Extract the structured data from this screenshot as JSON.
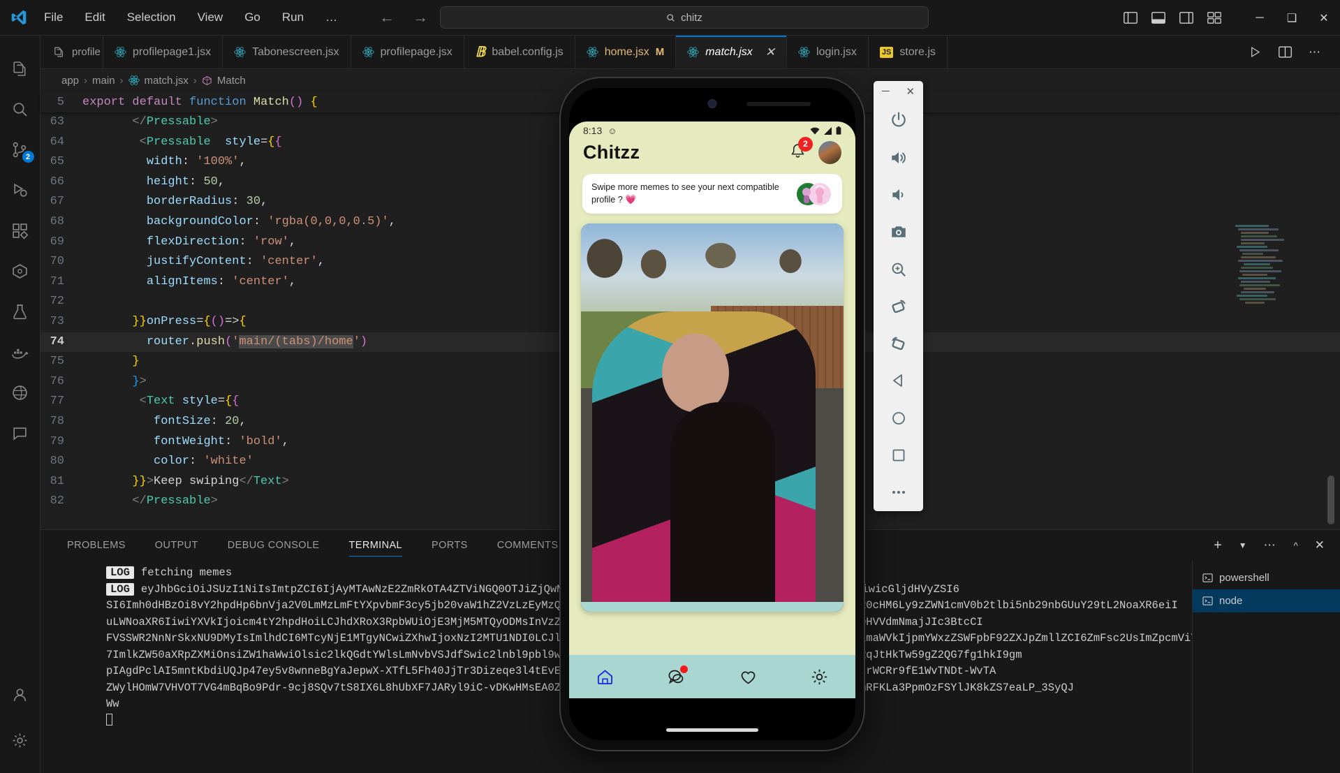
{
  "titlebar": {
    "menu": [
      "File",
      "Edit",
      "Selection",
      "View",
      "Go",
      "Run",
      "…"
    ],
    "search_value": "chitz",
    "search_icon": "search-icon",
    "back_icon": "arrow-left-icon",
    "forward_icon": "arrow-right-icon",
    "minimize": "─",
    "maximize": "❑",
    "close": "✕"
  },
  "activitybar": {
    "items": [
      {
        "name": "explorer",
        "icon": "files-icon",
        "badge": ""
      },
      {
        "name": "search",
        "icon": "search-icon",
        "badge": ""
      },
      {
        "name": "source-control",
        "icon": "source-control-icon",
        "badge": "2"
      },
      {
        "name": "run-and-debug",
        "icon": "run-debug-icon",
        "badge": ""
      },
      {
        "name": "extensions",
        "icon": "extensions-icon",
        "badge": ""
      },
      {
        "name": "remote-explorer",
        "icon": "remote-explorer-icon",
        "badge": ""
      },
      {
        "name": "testing",
        "icon": "beaker-icon",
        "badge": ""
      },
      {
        "name": "docker",
        "icon": "docker-icon",
        "badge": ""
      },
      {
        "name": "database",
        "icon": "database-icon",
        "badge": ""
      },
      {
        "name": "chat",
        "icon": "comment-icon",
        "badge": ""
      }
    ],
    "bottom": [
      {
        "name": "accounts",
        "icon": "account-icon"
      },
      {
        "name": "settings",
        "icon": "gear-icon"
      }
    ]
  },
  "tabbar": {
    "sidebar_label": "profile",
    "tabs": [
      {
        "label": "profilepage1.jsx",
        "icon": "react-icon",
        "active": false,
        "modified": "",
        "closeable": false
      },
      {
        "label": "Tabonescreen.jsx",
        "icon": "react-icon",
        "active": false,
        "modified": "",
        "closeable": false
      },
      {
        "label": "profilepage.jsx",
        "icon": "react-icon",
        "active": false,
        "modified": "",
        "closeable": false
      },
      {
        "label": "babel.config.js",
        "icon": "babel-icon",
        "active": false,
        "modified": "",
        "closeable": false
      },
      {
        "label": "home.jsx",
        "icon": "react-icon",
        "active": false,
        "modified": "M",
        "closeable": false
      },
      {
        "label": "match.jsx",
        "icon": "react-icon",
        "active": true,
        "modified": "",
        "closeable": true
      },
      {
        "label": "login.jsx",
        "icon": "react-icon",
        "active": false,
        "modified": "",
        "closeable": false
      },
      {
        "label": "store.js",
        "icon": "js-icon",
        "active": false,
        "modified": "",
        "closeable": false
      }
    ],
    "actions": [
      {
        "name": "run-file-button",
        "icon": "play-icon"
      },
      {
        "name": "split-editor-button",
        "icon": "split-icon"
      },
      {
        "name": "more-actions-button",
        "icon": "ellipsis-icon"
      }
    ]
  },
  "breadcrumb": {
    "parts": [
      "app",
      "main",
      "match.jsx",
      "Match"
    ]
  },
  "editor": {
    "sticky_line_number": "5",
    "sticky_code": "export default function Match() {",
    "current_line": "74",
    "lines": [
      {
        "n": "63",
        "indent": 7,
        "text": "</Pressable>"
      },
      {
        "n": "64",
        "indent": 8,
        "text": "<Pressable  style={{"
      },
      {
        "n": "65",
        "indent": 9,
        "text": "width: '100%',"
      },
      {
        "n": "66",
        "indent": 9,
        "text": "height: 50,"
      },
      {
        "n": "67",
        "indent": 9,
        "text": "borderRadius: 30,"
      },
      {
        "n": "68",
        "indent": 9,
        "text": "backgroundColor: 'rgba(0,0,0,0.5)',"
      },
      {
        "n": "69",
        "indent": 9,
        "text": "flexDirection: 'row',"
      },
      {
        "n": "70",
        "indent": 9,
        "text": "justifyContent: 'center',"
      },
      {
        "n": "71",
        "indent": 9,
        "text": "alignItems: 'center',"
      },
      {
        "n": "72",
        "indent": 0,
        "text": ""
      },
      {
        "n": "73",
        "indent": 7,
        "text": "}}onPress={()=>{"
      },
      {
        "n": "74",
        "indent": 9,
        "text": "router.push('main/(tabs)/home')"
      },
      {
        "n": "75",
        "indent": 7,
        "text": "}"
      },
      {
        "n": "76",
        "indent": 7,
        "text": "}>"
      },
      {
        "n": "77",
        "indent": 8,
        "text": "<Text style={{"
      },
      {
        "n": "78",
        "indent": 10,
        "text": "fontSize: 20,"
      },
      {
        "n": "79",
        "indent": 10,
        "text": "fontWeight: 'bold',"
      },
      {
        "n": "80",
        "indent": 10,
        "text": "color: 'white'"
      },
      {
        "n": "81",
        "indent": 7,
        "text": "}}>Keep swiping</Text>"
      },
      {
        "n": "82",
        "indent": 7,
        "text": "</Pressable>"
      }
    ]
  },
  "panel": {
    "tabs": [
      "PROBLEMS",
      "OUTPUT",
      "DEBUG CONSOLE",
      "TERMINAL",
      "PORTS",
      "COMMENTS"
    ],
    "active_tab": "TERMINAL",
    "actions": [
      {
        "name": "new-terminal-button",
        "icon": "plus-icon"
      },
      {
        "name": "terminal-dropdown-button",
        "icon": "chevron-down-icon"
      },
      {
        "name": "panel-more-button",
        "icon": "ellipsis-icon"
      },
      {
        "name": "maximize-panel-button",
        "icon": "chevron-up-icon"
      },
      {
        "name": "close-panel-button",
        "icon": "close-icon"
      }
    ],
    "terminal_lines": [
      {
        "tag": "LOG",
        "text": "fetching memes"
      },
      {
        "tag": "LOG",
        "text": "eyJhbGciOiJSUzI1NiIsImtpZCI6IjAyMTAwNzE2ZmRkOTA4ZTViNGQ0OTJiZjQwMzU5MmYxY2Q3NmMyNGMifQ.eyJuYW1lIjoiRGV2YW5cCBCIiwicGljdHVyZSI6"
      },
      {
        "tag": "",
        "text": "SI6Imh0dHBzOi8vY2hpdHp6bnVja2V0LmMzLmFtYXpvbmF3cy5jb20vaW1hZ2VzLzEyMzQ1Njc4OTAiLCJpc3MiOiJodHRwczovL3NlY3VyZXRva2VuHR0cHM6Ly9zZWN1cmV0b2tlbi5nb29nbGUuY29tL2NoaXR6eiI"
      },
      {
        "tag": "",
        "text": "uLWNoaXR6IiwiYXVkIjoicm4tY2hpdHoiLCJhdXRoX3RpbWUiOjE3MjM5MTQyODMsInVzZXJfaWQiOiJ2c2t2c2t2c2tQnE1T0MzIiwic3ViIjoiNGJJOHVVdmNmajJIc3BtcCI"
      },
      {
        "tag": "",
        "text": "FVSSWR2NnNrSkxNU9DMyIsImlhdCI6MTcyNjE1MTgyNCwiZXhwIjoxNzI2MTU1NDI0LCJlbWFpbCI6ImRldmFuQGdtYWlsLmNvbSIsImVtYWlsX3ZlcmlmaWVkIjpmYWxzZSWFpbF92ZXJpZmllZCI6ZmFsc2UsImZpcmViYXNlIjp"
      },
      {
        "tag": "",
        "text": "7ImlkZW50aXRpZXMiOnsiZW1haWwiOlsic2lkQGdtYWlsLmNvbVSJdfSwic2lnbl9pbl9wcm92aWRlciI6InBhc3N3b3JkIn19chsA-oxswv5o-aOciqRqJtHkTw59gZ2QG7fg1hkI9gm"
      },
      {
        "tag": "",
        "text": "pIAgdPclAI5mntKbdiUQJp47ey5v8wnneBgYaJepwX-XTfL5Fh40JjTr3Dizeqe3l4tEvEOPcvXIIgjI_6YfZ4mP8wQeIOK3bApTI_bDsUTn02_jh9ei2rWCRr9fE1WvTNDt-WvTA"
      },
      {
        "tag": "",
        "text": "ZWylHOmW7VHVOT7VG4mBqBo9Pdr-9cj8SQv7tS8IX6L8hUbXF7JARyl9iC-vDKwHMsEA0ZRJyCtDv5Jf3zq1EpNuNb3EgNkFtCbtFOhpSsB6ZPVPw8UCmRFKLa3PpmOzFSYlJK8kZS7eaLP_3SyQJ"
      },
      {
        "tag": "",
        "text": "Ww"
      }
    ],
    "cursor": "▋",
    "side_items": [
      {
        "label": "powershell",
        "icon": "terminal-icon",
        "active": false
      },
      {
        "label": "node",
        "icon": "terminal-icon",
        "active": true
      }
    ]
  },
  "emulator": {
    "window_controls": {
      "minimize": "─",
      "close": "✕"
    },
    "buttons": [
      {
        "name": "power-button",
        "icon": "power-icon"
      },
      {
        "name": "volume-up-button",
        "icon": "volume-up-icon"
      },
      {
        "name": "volume-down-button",
        "icon": "volume-down-icon"
      },
      {
        "name": "screenshot-button",
        "icon": "camera-icon"
      },
      {
        "name": "zoom-button",
        "icon": "zoom-in-icon"
      },
      {
        "name": "rotate-left-button",
        "icon": "rotate-left-icon"
      },
      {
        "name": "rotate-right-button",
        "icon": "rotate-right-icon"
      },
      {
        "name": "back-button",
        "icon": "triangle-back-icon"
      },
      {
        "name": "home-button",
        "icon": "circle-home-icon"
      },
      {
        "name": "overview-button",
        "icon": "square-overview-icon"
      },
      {
        "name": "extended-controls-button",
        "icon": "ellipsis-icon"
      }
    ]
  },
  "phone_app": {
    "status_time": "8:13",
    "status_left_icon": "emoji-icon",
    "status_right_icons": [
      "wifi-icon",
      "signal-icon",
      "battery-icon"
    ],
    "title": "Chitzz",
    "bell_icon": "bell-icon",
    "bell_badge": "2",
    "avatar_icon": "avatar",
    "banner_text": "Swipe more memes to see your next  compatible profile ?",
    "banner_emoji": "💗",
    "banner_thumb": "couple-illustration",
    "bottom_nav": [
      {
        "name": "home-tab",
        "icon": "home-icon",
        "active": true,
        "badge": false
      },
      {
        "name": "chat-tab",
        "icon": "chat-icon",
        "active": false,
        "badge": true
      },
      {
        "name": "likes-tab",
        "icon": "heart-icon",
        "active": false,
        "badge": false
      },
      {
        "name": "settings-tab",
        "icon": "gear-icon",
        "active": false,
        "badge": false
      }
    ]
  }
}
